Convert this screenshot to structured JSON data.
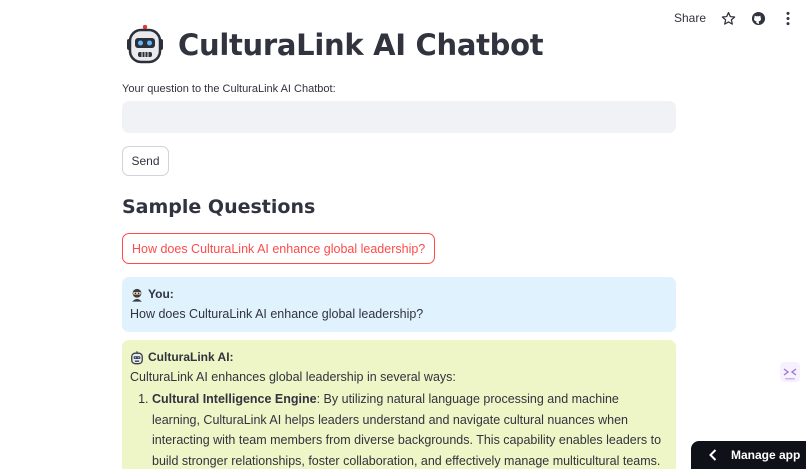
{
  "topbar": {
    "share_label": "Share",
    "icons": [
      "star-icon",
      "github-icon",
      "more-vertical-icon"
    ]
  },
  "header": {
    "title": "CulturaLink AI Chatbot",
    "logo_icon": "robot-icon"
  },
  "question_input": {
    "label": "Your question to the CulturaLink AI Chatbot:",
    "value": "",
    "placeholder": ""
  },
  "send_button": {
    "label": "Send"
  },
  "sample_section": {
    "title": "Sample Questions",
    "questions": [
      "How does CulturaLink AI enhance global leadership?"
    ]
  },
  "chat": {
    "user": {
      "sender": "You:",
      "icon": "user-ninja-icon",
      "text": "How does CulturaLink AI enhance global leadership?"
    },
    "ai": {
      "sender": "CulturaLink AI:",
      "icon": "robot-face-icon",
      "intro": "CulturaLink AI enhances global leadership in several ways:",
      "points": [
        {
          "title": "Cultural Intelligence Engine",
          "text": ": By utilizing natural language processing and machine learning, CulturaLink AI helps leaders understand and navigate cultural nuances when interacting with team members from diverse backgrounds. This capability enables leaders to build stronger relationships, foster collaboration, and effectively manage multicultural teams."
        }
      ]
    }
  },
  "footer": {
    "manage_app_label": "Manage app"
  },
  "colors": {
    "accent_red": "#ff4b4b",
    "user_bubble": "#e0f2fd",
    "ai_bubble": "#eef5c6",
    "input_bg": "#f0f2f6",
    "text": "#31333f",
    "manage_bg": "#0e1117"
  }
}
